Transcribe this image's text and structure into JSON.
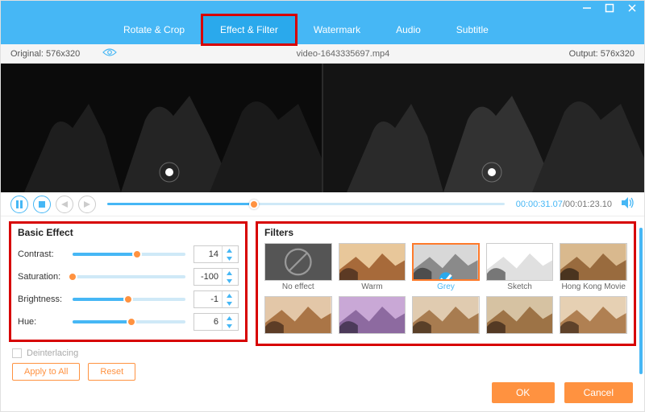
{
  "window": {
    "minimize_icon": "minimize",
    "maximize_icon": "maximize",
    "close_icon": "close"
  },
  "tabs": {
    "items": [
      {
        "label": "Rotate & Crop"
      },
      {
        "label": "Effect & Filter"
      },
      {
        "label": "Watermark"
      },
      {
        "label": "Audio"
      },
      {
        "label": "Subtitle"
      }
    ],
    "active_index": 1
  },
  "infobar": {
    "original_label": "Original: 576x320",
    "filename": "video-1643335697.mp4",
    "output_label": "Output: 576x320"
  },
  "playback": {
    "progress_pct": 37,
    "current_time": "00:00:31.07",
    "total_time": "/00:01:23.10"
  },
  "basic_effect": {
    "title": "Basic Effect",
    "rows": [
      {
        "label": "Contrast:",
        "value": "14",
        "pct": 57
      },
      {
        "label": "Saturation:",
        "value": "-100",
        "pct": 0
      },
      {
        "label": "Brightness:",
        "value": "-1",
        "pct": 49
      },
      {
        "label": "Hue:",
        "value": "6",
        "pct": 52
      }
    ],
    "deinterlacing_label": "Deinterlacing",
    "apply_label": "Apply to All",
    "reset_label": "Reset"
  },
  "filters": {
    "title": "Filters",
    "items": [
      {
        "label": "No effect"
      },
      {
        "label": "Warm"
      },
      {
        "label": "Grey",
        "selected": true
      },
      {
        "label": "Sketch"
      },
      {
        "label": "Hong Kong Movie"
      },
      {
        "label": ""
      },
      {
        "label": ""
      },
      {
        "label": ""
      },
      {
        "label": ""
      },
      {
        "label": ""
      }
    ]
  },
  "footer": {
    "ok": "OK",
    "cancel": "Cancel"
  }
}
